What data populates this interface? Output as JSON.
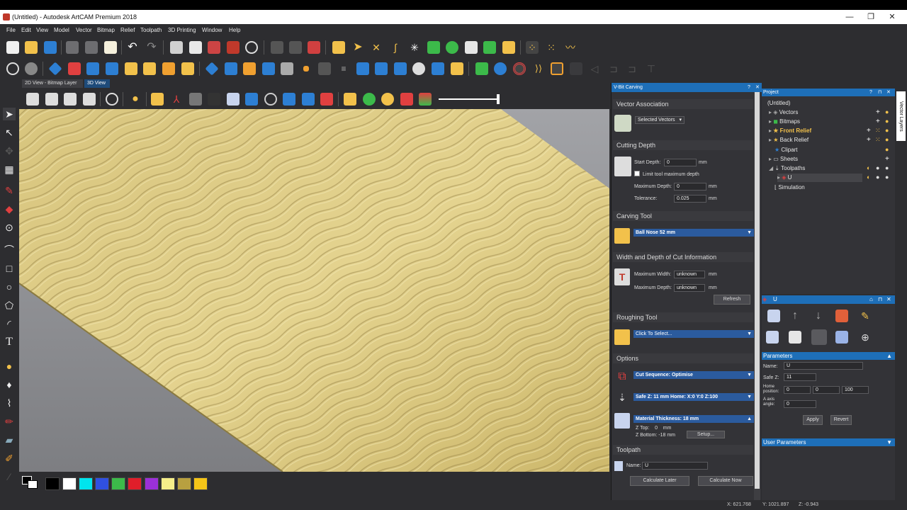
{
  "window": {
    "title": "(Untitled) - Autodesk ArtCAM Premium 2018",
    "minimize": "—",
    "restore": "❐",
    "close": "✕"
  },
  "menu": [
    "File",
    "Edit",
    "View",
    "Model",
    "Vector",
    "Bitmap",
    "Relief",
    "Toolpath",
    "3D Printing",
    "Window",
    "Help"
  ],
  "view_tabs": [
    "2D View - Bitmap Layer",
    "3D View"
  ],
  "vbit": {
    "title": "V-Bit Carving",
    "help": "?",
    "close": "✕",
    "vector_association": {
      "heading": "Vector Association",
      "selection": "Selected Vectors"
    },
    "cutting_depth": {
      "heading": "Cutting Depth",
      "start_depth_label": "Start Depth:",
      "start_depth_value": "0",
      "start_unit": "mm",
      "limit_label": "Limit tool maximum depth",
      "max_depth_label": "Maximum Depth:",
      "max_depth_value": "0",
      "max_unit": "mm",
      "tolerance_label": "Tolerance:",
      "tolerance_value": "0.025",
      "tol_unit": "mm"
    },
    "carving_tool": {
      "heading": "Carving Tool",
      "tool": "Ball Nose 52 mm"
    },
    "width_depth": {
      "heading": "Width and Depth of Cut Information",
      "max_width_label": "Maximum Width:",
      "max_width_value": "unknown",
      "width_unit": "mm",
      "max_depth_label": "Maximum Depth:",
      "max_depth_value": "unknown",
      "depth_unit": "mm",
      "refresh": "Refresh"
    },
    "roughing_tool": {
      "heading": "Roughing Tool",
      "tool": "Click To Select..."
    },
    "options": {
      "heading": "Options",
      "cut_sequence": "Cut Sequence: Optimise",
      "safe_home": "Safe Z: 11 mm  Home: X:0 Y:0 Z:100",
      "material": "Material Thickness: 18 mm",
      "z_top": "Z Top:    0    mm",
      "z_bottom": "Z Bottom: -18 mm",
      "setup": "Setup..."
    },
    "toolpath": {
      "heading": "Toolpath",
      "name_label": "Name:",
      "name_value": "U",
      "calc_later": "Calculate Later",
      "calc_now": "Calculate Now"
    }
  },
  "project": {
    "title": "Project",
    "items": [
      {
        "label": "(Untitled)",
        "highlight": false
      },
      {
        "label": "Vectors",
        "highlight": false
      },
      {
        "label": "Bitmaps",
        "highlight": false
      },
      {
        "label": "Front Relief",
        "highlight": true
      },
      {
        "label": "Back Relief",
        "highlight": false
      },
      {
        "label": "Clipart",
        "highlight": false
      },
      {
        "label": "Sheets",
        "highlight": false
      },
      {
        "label": "Toolpaths",
        "highlight": false
      },
      {
        "label": "U",
        "highlight": false
      },
      {
        "label": "Simulation",
        "highlight": false
      }
    ]
  },
  "toolpath_panel": {
    "title": "U",
    "parameters_heading": "Parameters",
    "name_label": "Name:",
    "name_value": "U",
    "safez_label": "Safe Z:",
    "safez_value": "11",
    "home_label": "Home position:",
    "home_x": "0",
    "home_y": "0",
    "home_z": "100",
    "axis_label": "A axis angle:",
    "axis_value": "0",
    "apply": "Apply",
    "revert": "Revert",
    "user_params_heading": "User Parameters"
  },
  "right_tab": "Vector Layers",
  "status": {
    "x": "X: 621.768",
    "y": "Y: 1021.897",
    "z": "Z: -0.943"
  },
  "palette": [
    "#000000",
    "#ffffff",
    "#00e5ee",
    "#3050e0",
    "#3cba4a",
    "#e01e2a",
    "#9b30d8",
    "#f5ee8a",
    "#b8a040",
    "#f5c518"
  ]
}
